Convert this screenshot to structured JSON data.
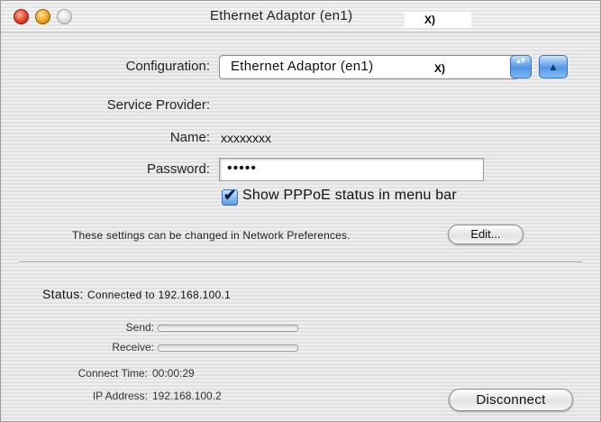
{
  "window": {
    "title": "Ethernet Adaptor (en1)",
    "title_suffix": "X)"
  },
  "config": {
    "label": "Configuration:",
    "selected": "Ethernet Adaptor (en1)",
    "selected_suffix": "X)",
    "stepper_glyph": "▴▾",
    "disclosure_glyph": "▲"
  },
  "provider": {
    "heading": "Service Provider:",
    "name_label": "Name:",
    "name_value": "xxxxxxxx",
    "password_label": "Password:",
    "password_value": "•••••"
  },
  "options": {
    "show_status_label": "Show PPPoE status in menu bar",
    "show_status_checked": true,
    "checkmark_glyph": "✔"
  },
  "info": {
    "text": "These settings can be changed in Network Preferences.",
    "edit_button": "Edit..."
  },
  "status": {
    "label": "Status:",
    "value": "Connected to 192.168.100.1",
    "send_label": "Send:",
    "send_level": 0,
    "receive_label": "Receive:",
    "receive_level": 0,
    "connect_time_label": "Connect Time:",
    "connect_time_value": "00:00:29",
    "ip_label": "IP Address:",
    "ip_value": "192.168.100.2",
    "disconnect_button": "Disconnect"
  },
  "colors": {
    "accent": "#4f95e4",
    "close": "#e0412a",
    "minimize": "#efa520",
    "zoom": "#dcdcdc"
  }
}
